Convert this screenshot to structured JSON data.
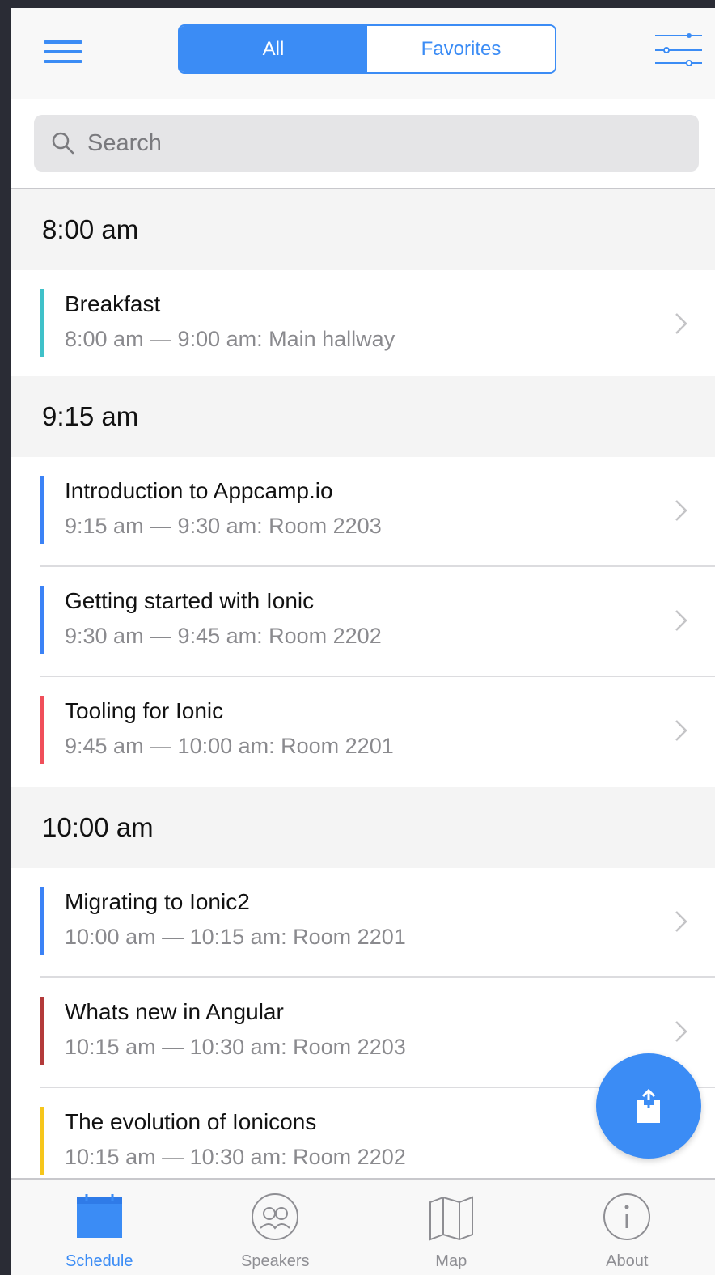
{
  "colors": {
    "accent": "#3b8cf5",
    "teal": "#3fc1c9",
    "blue": "#3b82f6",
    "red": "#f04f5a",
    "darkred": "#b33a3a",
    "yellow": "#f6c61b"
  },
  "header": {
    "segments": [
      {
        "label": "All",
        "active": true
      },
      {
        "label": "Favorites",
        "active": false
      }
    ],
    "menu_icon": "hamburger-menu-icon",
    "filter_icon": "sliders-filter-icon"
  },
  "search": {
    "placeholder": "Search",
    "value": ""
  },
  "schedule": {
    "groups": [
      {
        "time": "8:00 am",
        "sessions": [
          {
            "title": "Breakfast",
            "subtitle": "8:00 am — 9:00 am: Main hallway",
            "color": "#3fc1c9"
          }
        ]
      },
      {
        "time": "9:15 am",
        "sessions": [
          {
            "title": "Introduction to Appcamp.io",
            "subtitle": "9:15 am — 9:30 am: Room 2203",
            "color": "#3b82f6"
          },
          {
            "title": "Getting started with Ionic",
            "subtitle": "9:30 am — 9:45 am: Room 2202",
            "color": "#3b82f6"
          },
          {
            "title": "Tooling for Ionic",
            "subtitle": "9:45 am — 10:00 am: Room 2201",
            "color": "#f04f5a"
          }
        ]
      },
      {
        "time": "10:00 am",
        "sessions": [
          {
            "title": "Migrating to Ionic2",
            "subtitle": "10:00 am — 10:15 am: Room 2201",
            "color": "#3b82f6"
          },
          {
            "title": "Whats new in Angular",
            "subtitle": "10:15 am — 10:30 am: Room 2203",
            "color": "#b33a3a"
          },
          {
            "title": "The evolution of Ionicons",
            "subtitle": "10:15 am — 10:30 am: Room 2202",
            "color": "#f6c61b"
          }
        ]
      }
    ]
  },
  "fab": {
    "icon": "share-icon"
  },
  "tabs": [
    {
      "label": "Schedule",
      "icon": "calendar-icon",
      "active": true
    },
    {
      "label": "Speakers",
      "icon": "speakers-icon",
      "active": false
    },
    {
      "label": "Map",
      "icon": "map-icon",
      "active": false
    },
    {
      "label": "About",
      "icon": "info-icon",
      "active": false
    }
  ]
}
